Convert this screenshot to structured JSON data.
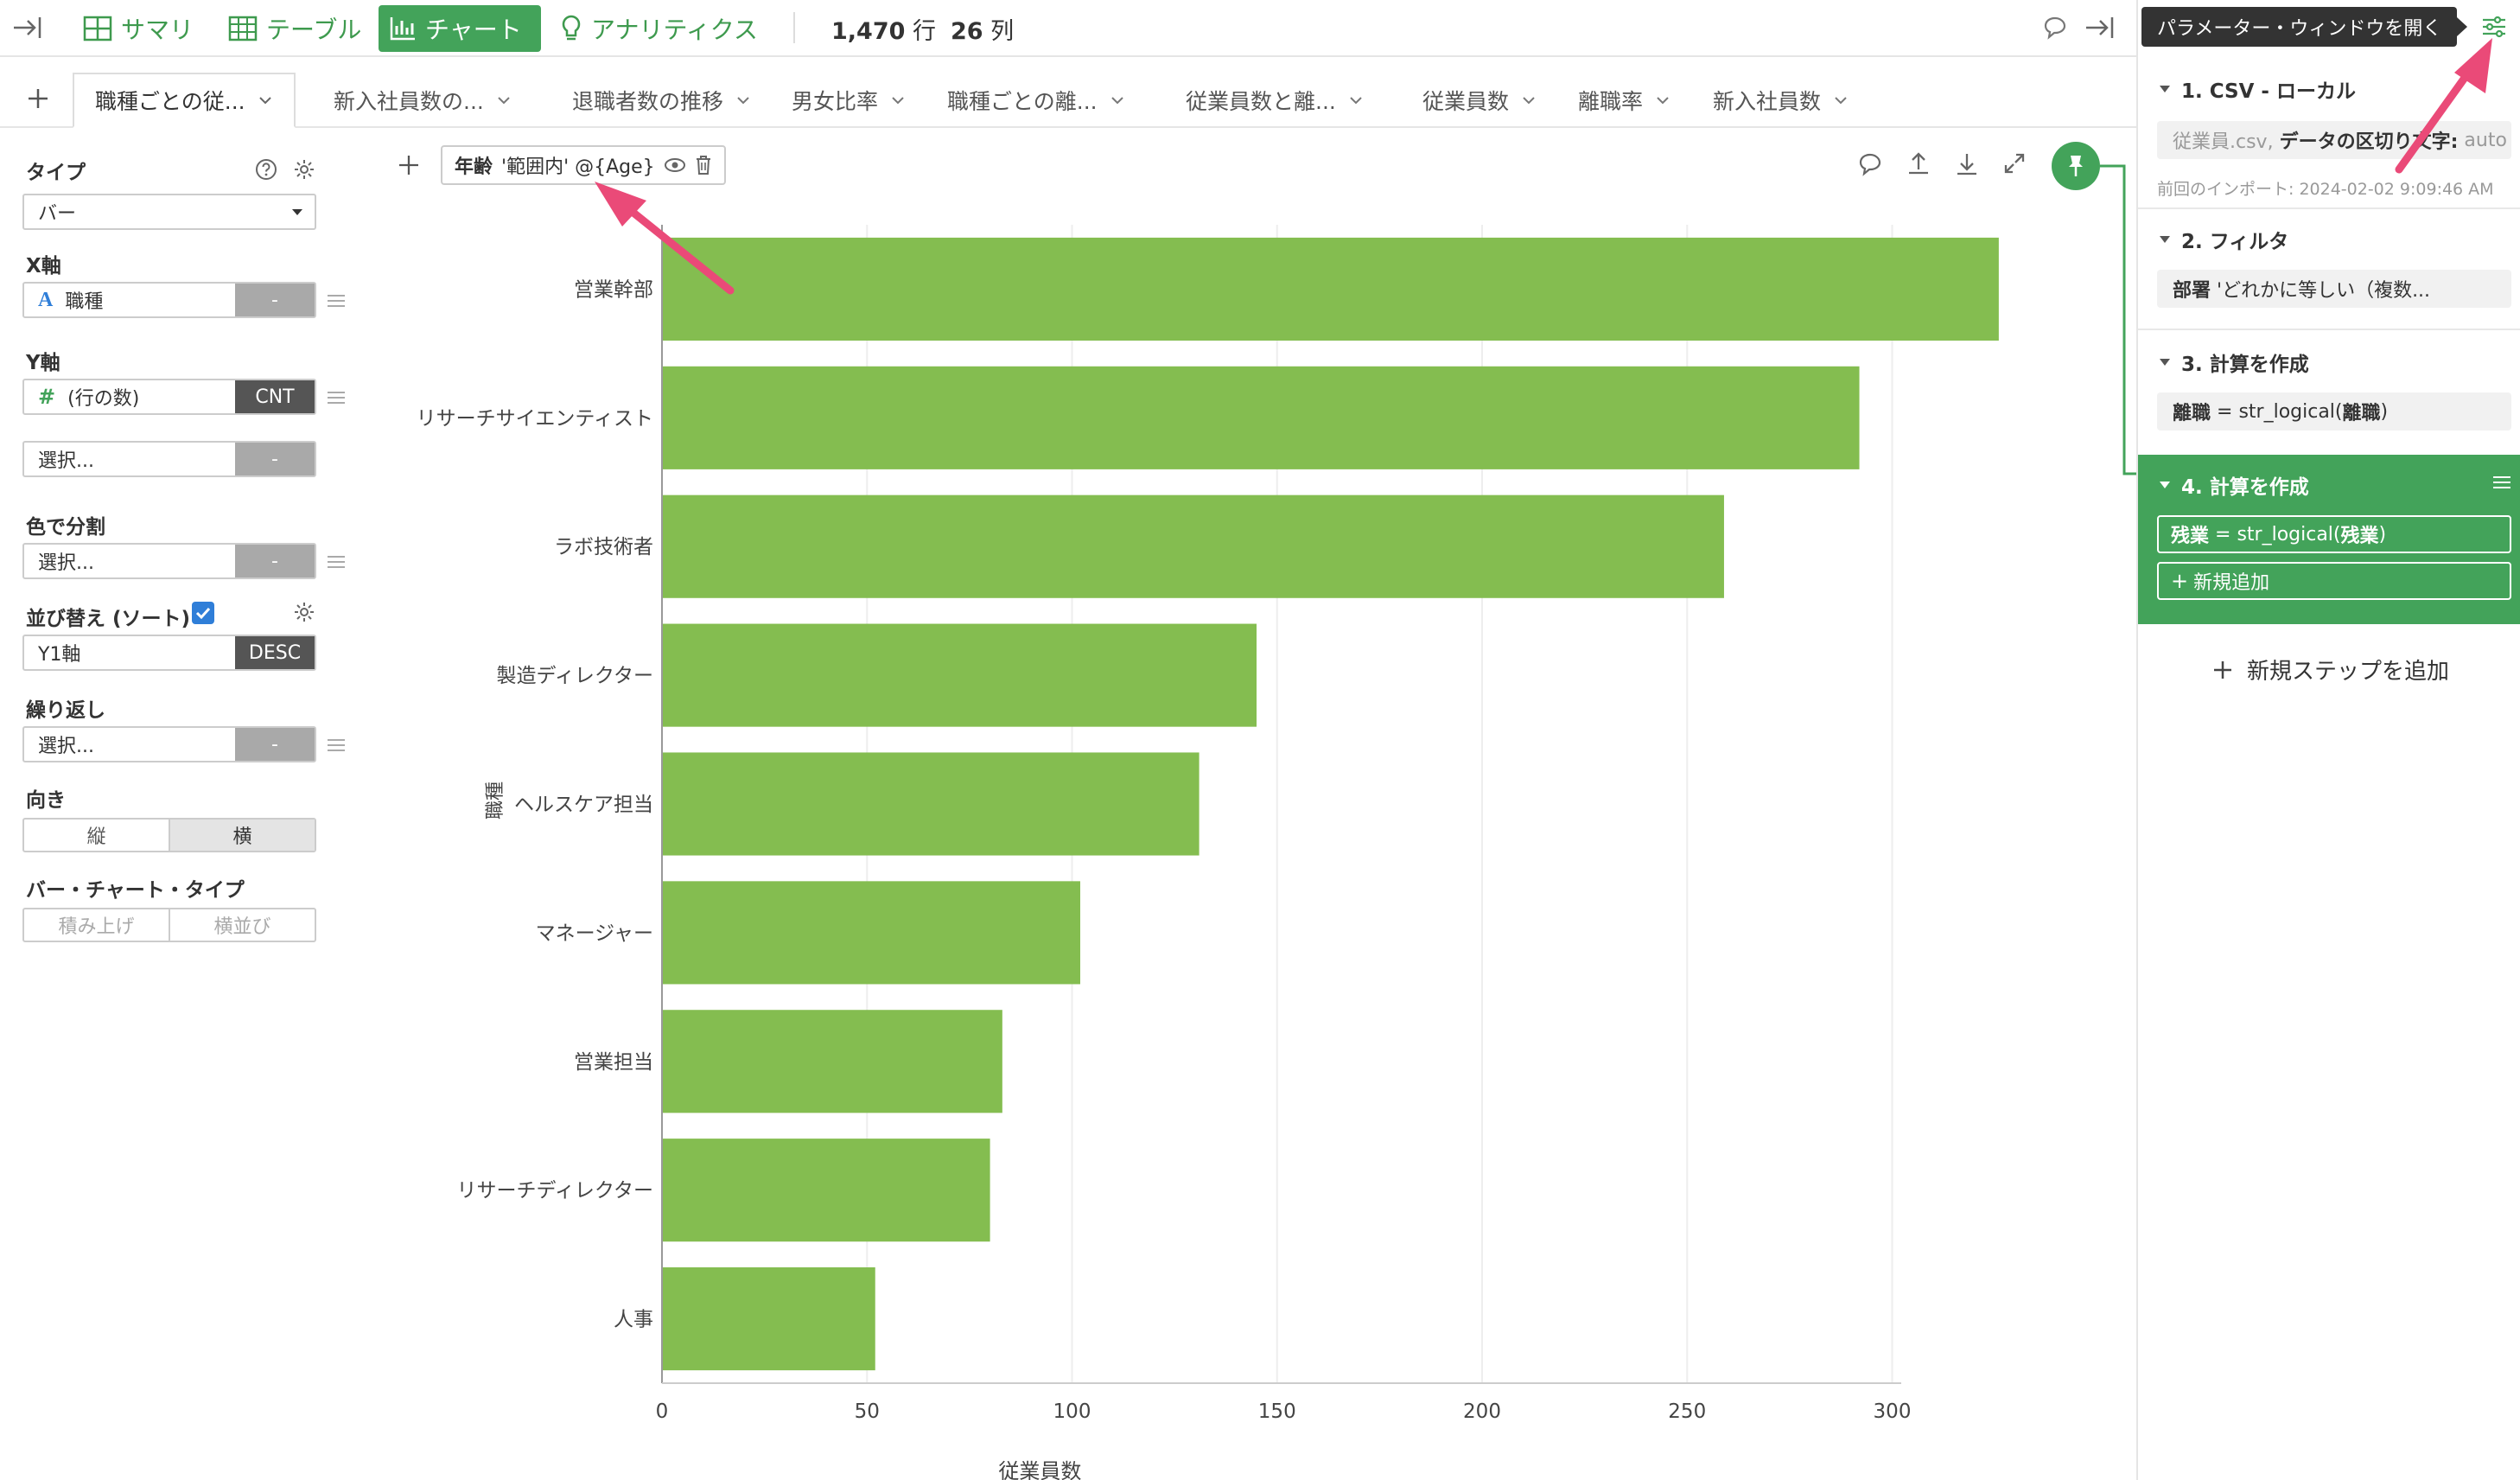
{
  "topbar": {
    "summary": "サマリ",
    "table": "テーブル",
    "chart": "チャート",
    "analytics": "アナリティクス",
    "rows_num": "1,470",
    "rows_unit": "行",
    "cols_num": "26",
    "cols_unit": "列"
  },
  "tabs": [
    {
      "label": "職種ごとの従..."
    },
    {
      "label": "新入社員数の..."
    },
    {
      "label": "退職者数の推移"
    },
    {
      "label": "男女比率"
    },
    {
      "label": "職種ごとの離..."
    },
    {
      "label": "従業員数と離..."
    },
    {
      "label": "従業員数"
    },
    {
      "label": "離職率"
    },
    {
      "label": "新入社員数"
    }
  ],
  "left": {
    "type_label": "タイプ",
    "type_value": "バー",
    "x_label": "X軸",
    "x_value": "職種",
    "x_tag": "-",
    "y_label": "Y軸",
    "y_value": "(行の数)",
    "y_tag": "CNT",
    "y2_value": "選択...",
    "y2_tag": "-",
    "color_label": "色で分割",
    "color_value": "選択...",
    "color_tag": "-",
    "sort_label": "並び替え (ソート)",
    "sort_value": "Y1軸",
    "sort_tag": "DESC",
    "repeat_label": "繰り返し",
    "repeat_value": "選択...",
    "repeat_tag": "-",
    "orient_label": "向き",
    "orient_vertical": "縦",
    "orient_horizontal": "横",
    "bartype_label": "バー・チャート・タイプ",
    "bartype_stack": "積み上げ",
    "bartype_side": "横並び"
  },
  "filter": {
    "field": "年齢",
    "condition": "'範囲内' @{Age}"
  },
  "chart_data": {
    "type": "bar",
    "orientation": "horizontal",
    "categories": [
      "営業幹部",
      "リサーチサイエンティスト",
      "ラボ技術者",
      "製造ディレクター",
      "ヘルスケア担当",
      "マネージャー",
      "営業担当",
      "リサーチディレクター",
      "人事"
    ],
    "values": [
      326,
      292,
      259,
      145,
      131,
      102,
      83,
      80,
      52
    ],
    "xlabel": "従業員数",
    "ylabel": "職種",
    "xlim": [
      0,
      330
    ],
    "xticks": [
      0,
      50,
      100,
      150,
      200,
      250,
      300
    ],
    "bar_color": "#84bd50",
    "grid": true
  },
  "right": {
    "tooltip": "パラメーター・ウィンドウを開く",
    "step1_title": "1. CSV - ローカル",
    "step1_file": "従業員.csv,",
    "step1_delim": "データの区切り文字:",
    "step1_delim_value": "auto",
    "step1_meta": "前回のインポート: 2024-02-02 9:09:46 AM",
    "step2_title": "2. フィルタ",
    "step2_field": "部署",
    "step2_rest": "'どれかに等しい（複数...",
    "step3_title": "3. 計算を作成",
    "step3_name": "離職",
    "step3_expr_pre": "= str_logical(",
    "step3_expr_arg": "離職",
    "step3_expr_post": ")",
    "step4_title": "4. 計算を作成",
    "step4_name": "残業",
    "step4_expr_pre": "= str_logical(",
    "step4_expr_arg": "残業",
    "step4_expr_post": ")",
    "step4_add": "新規追加",
    "add_step": "新規ステップを追加"
  },
  "colors": {
    "brand_green": "#43a35a",
    "bar_green": "#84bd50",
    "annotation_arrow": "#ea4a78"
  }
}
